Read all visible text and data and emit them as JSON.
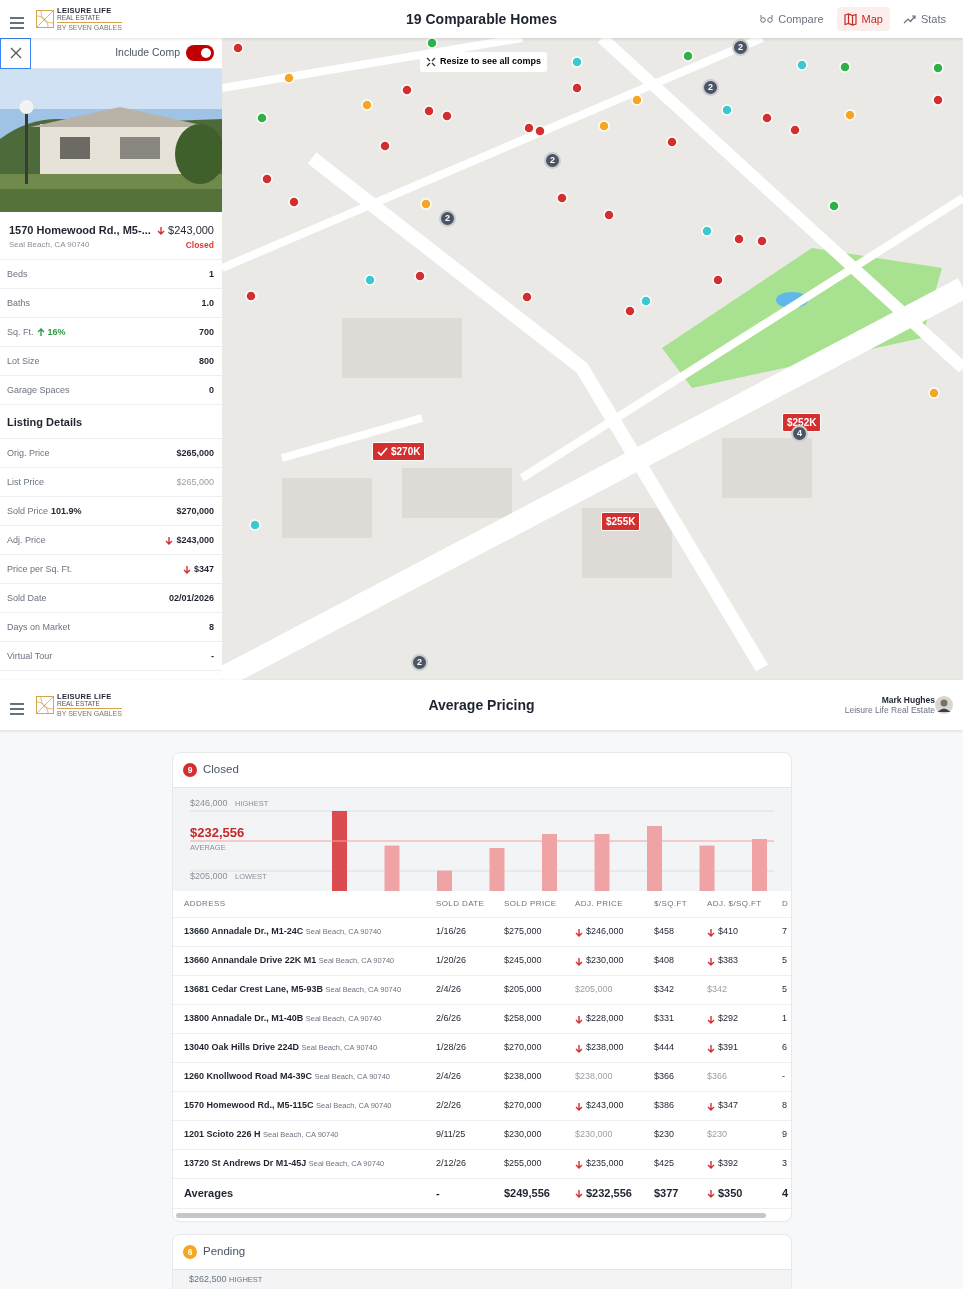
{
  "header": {
    "logo": {
      "name": "LEISURE LIFE",
      "line2": "REAL ESTATE",
      "line3": "BY SEVEN GABLES"
    },
    "title": "19 Comparable Homes",
    "tabs": [
      {
        "label": "Compare",
        "selected": false
      },
      {
        "label": "Map",
        "selected": true
      },
      {
        "label": "Stats",
        "selected": false
      }
    ]
  },
  "detail": {
    "include_comp": {
      "label": "Include Comp",
      "on": true
    },
    "address": "1570 Homewood Rd., M5-...",
    "city": "Seal Beach, CA 90740",
    "price": "$243,000",
    "price_down": true,
    "status": "Closed",
    "facts": [
      {
        "label": "Beds",
        "value": "1"
      },
      {
        "label": "Baths",
        "value": "1.0"
      },
      {
        "label": "Sq. Ft.",
        "note": "16%",
        "note_up": true,
        "value": "700"
      },
      {
        "label": "Lot Size",
        "value": "800"
      },
      {
        "label": "Garage Spaces",
        "value": "0"
      }
    ],
    "section_title": "Listing Details",
    "listing": [
      {
        "label": "Orig. Price",
        "value": "$265,000"
      },
      {
        "label": "List Price",
        "value": "$265,000",
        "muted": true
      },
      {
        "label": "Sold Price",
        "note": "101.9%",
        "value": "$270,000"
      },
      {
        "label": "Adj. Price",
        "value": "$243,000",
        "down": true
      },
      {
        "label": "Price per Sq. Ft.",
        "value": "$347",
        "down": true
      },
      {
        "label": "Sold Date",
        "value": "02/01/2026"
      },
      {
        "label": "Days on Market",
        "value": "8"
      },
      {
        "label": "Virtual Tour",
        "value": "-"
      }
    ]
  },
  "map": {
    "resize_button": "Resize to see all comps",
    "price_tags": [
      {
        "label": "$270K",
        "checked": true
      },
      {
        "label": "$252K",
        "checked": false
      },
      {
        "label": "$255K",
        "checked": false
      }
    ],
    "clusters": [
      "2",
      "2",
      "2",
      "2",
      "4",
      "2"
    ]
  },
  "pricing": {
    "header": {
      "logo": {
        "name": "LEISURE LIFE",
        "line2": "REAL ESTATE",
        "line3": "BY SEVEN GABLES"
      },
      "title": "Average Pricing",
      "user": {
        "name": "Mark Hughes",
        "company": "Leisure Life Real Estate"
      }
    },
    "groups": [
      {
        "status": "Closed",
        "count": "9",
        "color": "#d32f2f",
        "highest": {
          "value": "$246,000",
          "label": "HIGHEST"
        },
        "average": {
          "value": "$232,556",
          "label": "AVERAGE"
        },
        "lowest": {
          "value": "$205,000",
          "label": "LOWEST"
        },
        "bars": [
          {
            "selected": true
          },
          {
            "selected": false
          },
          {
            "selected": false
          },
          {
            "selected": false
          },
          {
            "selected": false
          },
          {
            "selected": false
          },
          {
            "selected": false
          },
          {
            "selected": false
          },
          {
            "selected": false
          }
        ],
        "table": {
          "columns": [
            "ADDRESS",
            "SOLD DATE",
            "SOLD PRICE",
            "ADJ. PRICE",
            "$/SQ.FT",
            "ADJ. $/SQ.FT",
            "D"
          ],
          "rows": [
            {
              "kind": "home",
              "address": "13660 Annadale Dr., M1-24C",
              "city": "Seal Beach, CA 90740",
              "date": "1/16/26",
              "sold": "$275,000",
              "adj": {
                "text": "$246,000",
                "down": true
              },
              "psf": "$458",
              "adj_psf": {
                "text": "$410",
                "down": true
              },
              "column_7": "7"
            },
            {
              "kind": "home",
              "address": "13660 Annandale Drive 22K M1",
              "city": "Seal Beach, CA 90740",
              "date": "1/20/26",
              "sold": "$245,000",
              "adj": {
                "text": "$230,000",
                "down": true
              },
              "psf": "$408",
              "adj_psf": {
                "text": "$383",
                "down": true
              },
              "column_7": "5"
            },
            {
              "kind": "home",
              "address": "13681 Cedar Crest Lane, M5-93B",
              "city": "Seal Beach, CA 90740",
              "date": "2/4/26",
              "sold": "$205,000",
              "adj": {
                "text": "$205,000",
                "down": false
              },
              "psf": "$342",
              "adj_psf": {
                "text": "$342",
                "down": false
              },
              "column_7": "5"
            },
            {
              "kind": "home",
              "address": "13800 Annadale Dr., M1-40B",
              "city": "Seal Beach, CA 90740",
              "date": "2/6/26",
              "sold": "$258,000",
              "adj": {
                "text": "$228,000",
                "down": true
              },
              "psf": "$331",
              "adj_psf": {
                "text": "$292",
                "down": true
              },
              "column_7": "1"
            },
            {
              "kind": "home",
              "address": "13040 Oak Hills Drive 224D",
              "city": "Seal Beach, CA 90740",
              "date": "1/28/26",
              "sold": "$270,000",
              "adj": {
                "text": "$238,000",
                "down": true
              },
              "psf": "$444",
              "adj_psf": {
                "text": "$391",
                "down": true
              },
              "column_7": "6"
            },
            {
              "kind": "home",
              "address": "1260 Knollwood Road M4-39C",
              "city": "Seal Beach, CA 90740",
              "date": "2/4/26",
              "sold": "$238,000",
              "adj": {
                "text": "$238,000",
                "down": false
              },
              "psf": "$366",
              "adj_psf": {
                "text": "$366",
                "down": false
              },
              "column_7": "-"
            },
            {
              "kind": "home",
              "address": "1570 Homewood Rd., M5-115C",
              "city": "Seal Beach, CA 90740",
              "date": "2/2/26",
              "sold": "$270,000",
              "adj": {
                "text": "$243,000",
                "down": true
              },
              "psf": "$386",
              "adj_psf": {
                "text": "$347",
                "down": true
              },
              "column_7": "8"
            },
            {
              "kind": "home",
              "address": "1201 Scioto 226 H",
              "city": "Seal Beach, CA 90740",
              "date": "9/11/25",
              "sold": "$230,000",
              "adj": {
                "text": "$230,000",
                "down": false
              },
              "psf": "$230",
              "adj_psf": {
                "text": "$230",
                "down": false
              },
              "column_7": "9"
            },
            {
              "kind": "home",
              "address": "13720 St Andrews Dr M1-45J",
              "city": "Seal Beach, CA 90740",
              "date": "2/12/26",
              "sold": "$255,000",
              "adj": {
                "text": "$235,000",
                "down": true
              },
              "psf": "$425",
              "adj_psf": {
                "text": "$392",
                "down": true
              },
              "column_7": "3"
            },
            {
              "kind": "average",
              "address": "Averages",
              "date": "-",
              "sold": "$249,556",
              "adj": {
                "text": "$232,556",
                "down": true
              },
              "psf": "$377",
              "adj_psf": {
                "text": "$350",
                "down": true
              },
              "column_7": "4"
            }
          ]
        }
      },
      {
        "status": "Pending",
        "count": "6",
        "color": "#f5a623",
        "highest": {
          "value": "$262,500",
          "label": "HIGHEST"
        }
      }
    ]
  }
}
